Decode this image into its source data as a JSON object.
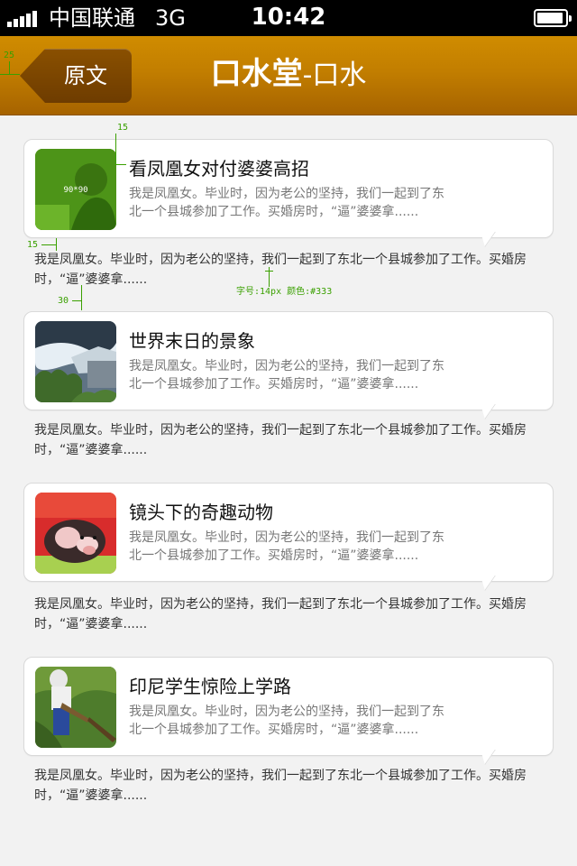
{
  "status_bar": {
    "carrier": "中国联通",
    "network": "3G",
    "time": "10:42"
  },
  "nav": {
    "back_label": "原文",
    "title_brand": "口水堂",
    "title_suffix": "-口水"
  },
  "annotations": {
    "left_margin": "25",
    "title_gap": "15",
    "thumb_size": "90*90",
    "comment_gap": "15",
    "item_gap": "30",
    "font_note": "字号:14px 颜色:#333"
  },
  "items": [
    {
      "title": "看凤凰女对付婆婆高招",
      "excerpt": "我是凤凰女。毕业时，因为老公的坚持，我们一起到了东北一个县城参加了工作。买婚房时，“逼”婆婆拿......",
      "comment": "我是凤凰女。毕业时，因为老公的坚持，我们一起到了东北一个县城参加了工作。买婚房时，“逼”婆婆拿......",
      "thumb_icon": "placeholder-image"
    },
    {
      "title": "世界末日的景象",
      "excerpt": "我是凤凰女。毕业时，因为老公的坚持，我们一起到了东北一个县城参加了工作。买婚房时，“逼”婆婆拿......",
      "comment": "我是凤凰女。毕业时，因为老公的坚持，我们一起到了东北一个县城参加了工作。买婚房时，“逼”婆婆拿......",
      "thumb_icon": "storm-photo"
    },
    {
      "title": "镜头下的奇趣动物",
      "excerpt": "我是凤凰女。毕业时，因为老公的坚持，我们一起到了东北一个县城参加了工作。买婚房时，“逼”婆婆拿......",
      "comment": "我是凤凰女。毕业时，因为老公的坚持，我们一起到了东北一个县城参加了工作。买婚房时，“逼”婆婆拿......",
      "thumb_icon": "pig-photo"
    },
    {
      "title": "印尼学生惊险上学路",
      "excerpt": "我是凤凰女。毕业时，因为老公的坚持，我们一起到了东北一个县城参加了工作。买婚房时，“逼”婆婆拿......",
      "comment": "我是凤凰女。毕业时，因为老公的坚持，我们一起到了东北一个县城参加了工作。买婚房时，“逼”婆婆拿......",
      "thumb_icon": "student-photo"
    }
  ],
  "colors": {
    "nav_top": "#d08c00",
    "nav_bottom": "#a66300",
    "back_button": "#7a4600",
    "annotation": "#3aa000",
    "comment_text": "#333333"
  }
}
